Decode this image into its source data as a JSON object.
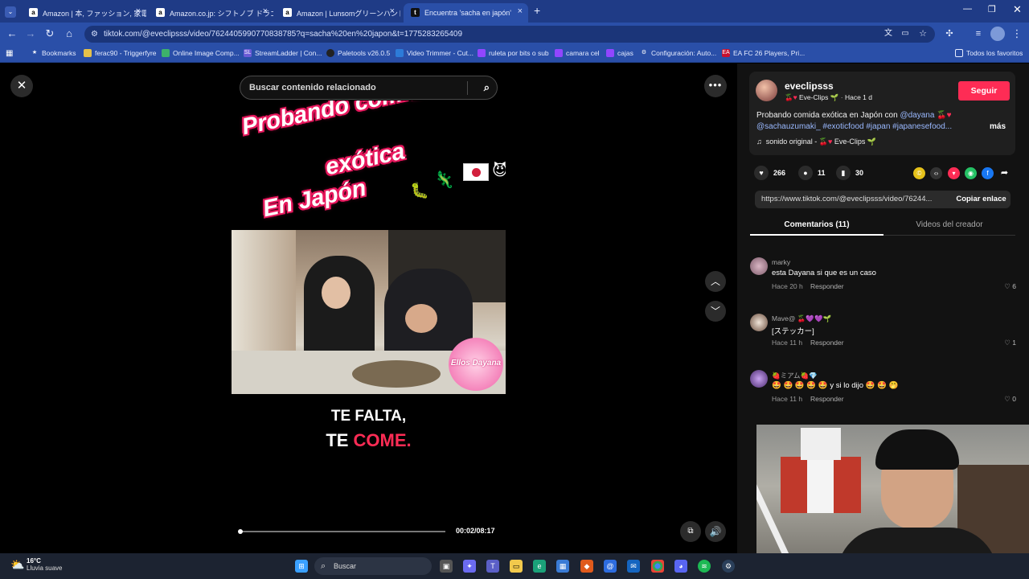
{
  "browser": {
    "tabs": [
      {
        "title": "Amazon | 本, ファッション, 家電から",
        "favicon": "a"
      },
      {
        "title": "Amazon.co.jp: シフトノブ ドラゴンボ",
        "favicon": "a"
      },
      {
        "title": "Amazon | Lunsomグリーンハンドル",
        "favicon": "a"
      },
      {
        "title": "Encuentra 'sacha en japón'",
        "favicon": "t"
      }
    ],
    "url": "tiktok.com/@eveclipsss/video/7624405990770838785?q=sacha%20en%20japon&t=1775283265409",
    "bookmarks": [
      "Bookmarks",
      "ferac90 - Triggerfyre",
      "Online Image Comp...",
      "StreamLadder | Con...",
      "Paletools v26.0.5",
      "Video Trimmer - Cut...",
      "ruleta por bits o sub",
      "camara cel",
      "cajas",
      "Configuración: Auto...",
      "EA FC 26 Players, Pri...",
      "Todos los favoritos"
    ]
  },
  "player": {
    "search_placeholder": "Buscar contenido relacionado",
    "headline": [
      "Probando comida",
      "exótica",
      "En Japón"
    ],
    "watermark": "Ellos Dayana",
    "caption_line1": "TE FALTA,",
    "caption_line2_white": "TE ",
    "caption_line2_pink": "COME.",
    "time": "00:02/08:17",
    "progress": 0.004
  },
  "sidebar": {
    "username": "eveclipsss",
    "display_name": "Eve-Clips",
    "age": "Hace 1 d",
    "follow_label": "Seguir",
    "desc_start": "Probando comida exótica en Japón con ",
    "mention1": "@dayana",
    "mention2": "@sachauzumaki_",
    "tags": "#exoticfood #japan #japanesefood...",
    "more": "más",
    "sound_prefix": "sonido original - ",
    "sound_name": "Eve-Clips",
    "likes": "266",
    "comments": "11",
    "saves": "30",
    "share_url": "https://www.tiktok.com/@eveclipsss/video/76244...",
    "copy_label": "Copiar enlace",
    "tab_comments": "Comentarios (11)",
    "tab_creator": "Videos del creador",
    "comment_list": [
      {
        "name": "marky",
        "text": "esta Dayana si que es un caso",
        "time": "Hace 20 h",
        "reply": "Responder",
        "likes": "6"
      },
      {
        "name": "Mave@",
        "text": "[ステッカー]",
        "time": "Hace 11 h",
        "reply": "Responder",
        "likes": "1"
      },
      {
        "name": "ミアム",
        "text": "🤩 🤩 🤩 🤩 🤩 y si lo dijo 🤩 🤩 🤭",
        "time": "Hace 11 h",
        "reply": "Responder",
        "likes": "0"
      }
    ]
  },
  "taskbar": {
    "temp": "16°C",
    "weather": "Lluvia suave",
    "search_label": "Buscar"
  },
  "colors": {
    "tiktok_pink": "#fe2c55",
    "chrome_blue": "#2a4fa8",
    "link": "#9ab9ff"
  }
}
